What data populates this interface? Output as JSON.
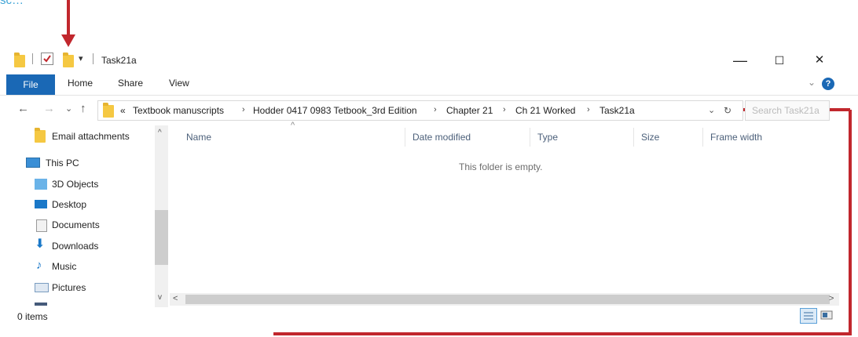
{
  "annotation": {
    "top_text": "sc…"
  },
  "window": {
    "title": "Task21a",
    "minimize": "—",
    "maximize": "☐",
    "close": "✕"
  },
  "ribbon": {
    "file": "File",
    "home": "Home",
    "share": "Share",
    "view": "View",
    "help": "?",
    "expand": "⌄"
  },
  "address": {
    "back": "←",
    "forward": "→",
    "recent": "⌄",
    "up": "↑",
    "overflow": "«",
    "crumbs": [
      "Textbook manuscripts",
      "Hodder 0417 0983 Tetbook_3rd Edition",
      "Chapter 21",
      "Ch 21 Worked",
      "Task21a"
    ],
    "separator": "›",
    "dropdown": "⌄",
    "refresh": "↻",
    "search_placeholder": "Search Task21a"
  },
  "navpane": {
    "items": [
      {
        "label": "Email attachments",
        "icon": "folder-icon"
      },
      {
        "label": "This PC",
        "icon": "computer-icon"
      },
      {
        "label": "3D Objects",
        "icon": "cube-icon"
      },
      {
        "label": "Desktop",
        "icon": "desktop-icon"
      },
      {
        "label": "Documents",
        "icon": "document-icon"
      },
      {
        "label": "Downloads",
        "icon": "download-icon"
      },
      {
        "label": "Music",
        "icon": "music-icon"
      },
      {
        "label": "Pictures",
        "icon": "picture-icon"
      }
    ]
  },
  "columns": [
    "Name",
    "Date modified",
    "Type",
    "Size",
    "Frame width"
  ],
  "sort_indicator": "^",
  "empty_message": "This folder is empty.",
  "status": {
    "items": "0 items"
  },
  "colors": {
    "accent": "#1a68b5",
    "annotation": "#c1272d",
    "folder": "#f5c842"
  }
}
